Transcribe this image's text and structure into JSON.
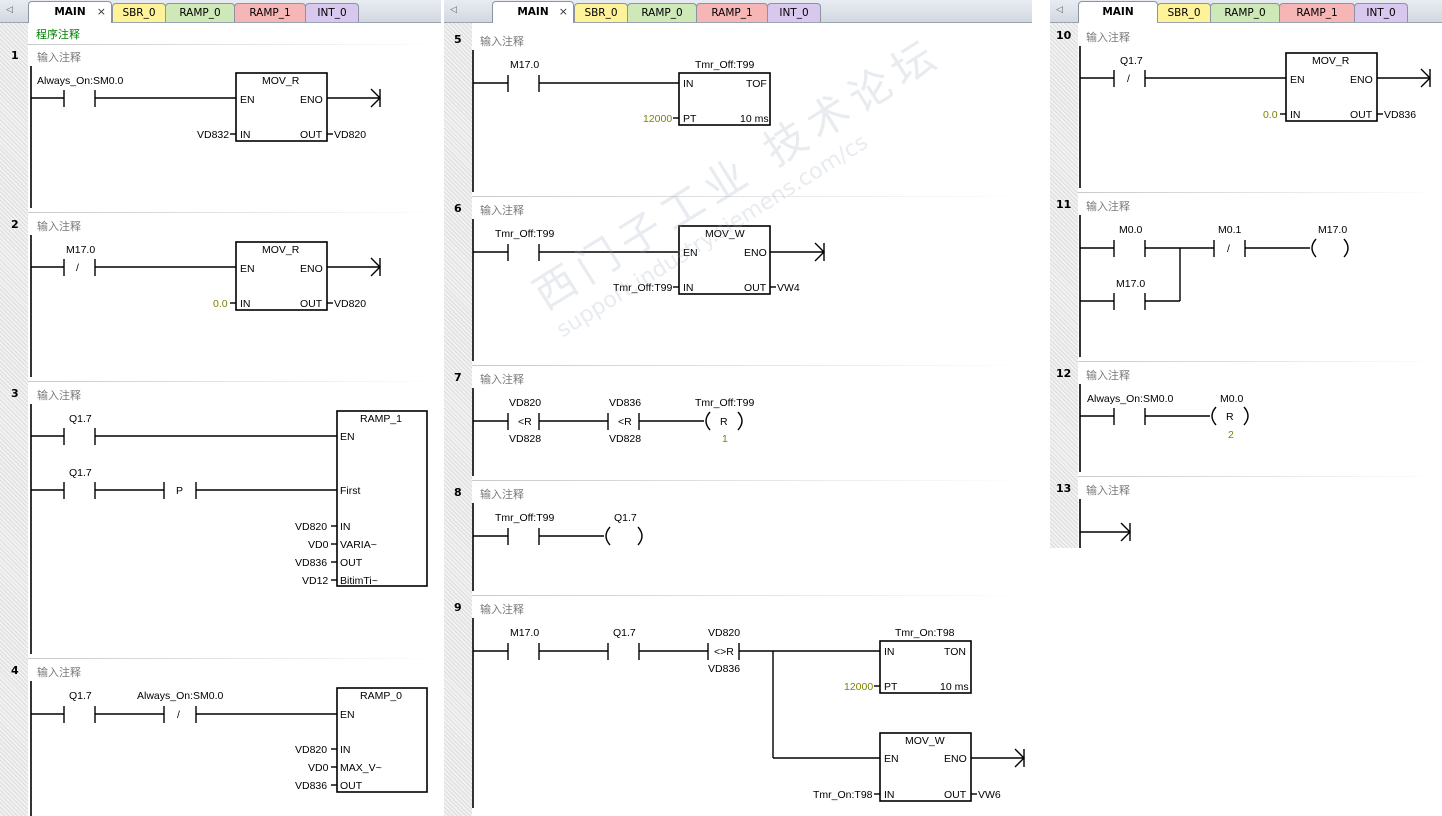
{
  "tabs": [
    "MAIN",
    "SBR_0",
    "RAMP_0",
    "RAMP_1",
    "INT_0"
  ],
  "program_comment": "程序注释",
  "rung_comment": "输入注释",
  "watermark": {
    "line1": "西门子工业 技术论坛",
    "line2": "support.industry.siemens.com/cs"
  },
  "rungs": {
    "r1": {
      "num": "1",
      "contact": "Always_On:SM0.0",
      "box": "MOV_R",
      "in": "VD832",
      "out": "VD820"
    },
    "r2": {
      "num": "2",
      "contact": "M17.0",
      "box": "MOV_R",
      "in": "0.0",
      "out": "VD820"
    },
    "r3": {
      "num": "3",
      "c1": "Q1.7",
      "c2": "Q1.7",
      "p": "P",
      "box": "RAMP_1",
      "pins": [
        "EN",
        "First",
        "IN",
        "VARIA~",
        "OUT",
        "BitimTi~"
      ],
      "args": [
        "VD820",
        "VD0",
        "VD836",
        "VD12"
      ]
    },
    "r4": {
      "num": "4",
      "c1": "Q1.7",
      "c2": "Always_On:SM0.0",
      "box": "RAMP_0",
      "pins": [
        "EN",
        "IN",
        "MAX_V~",
        "OUT"
      ],
      "args": [
        "VD820",
        "VD0",
        "VD836"
      ]
    },
    "r5": {
      "num": "5",
      "contact": "M17.0",
      "timer": "Tmr_Off:T99",
      "box": "TOF",
      "pt": "12000",
      "res": "10 ms"
    },
    "r6": {
      "num": "6",
      "contact": "Tmr_Off:T99",
      "box": "MOV_W",
      "in": "Tmr_Off:T99",
      "out": "VW4"
    },
    "r7": {
      "num": "7",
      "a1": "VD820",
      "op1": "<R",
      "b1": "VD828",
      "a2": "VD836",
      "op2": "<R",
      "b2": "VD828",
      "coil": "Tmr_Off:T99",
      "coil_type": "R",
      "n": "1"
    },
    "r8": {
      "num": "8",
      "contact": "Tmr_Off:T99",
      "coil": "Q1.7"
    },
    "r9": {
      "num": "9",
      "c1": "M17.0",
      "c2": "Q1.7",
      "a": "VD820",
      "op": "<>R",
      "b": "VD836",
      "timer": "Tmr_On:T98",
      "box1": "TON",
      "pt": "12000",
      "res": "10 ms",
      "box2": "MOV_W",
      "in": "Tmr_On:T98",
      "out": "VW6"
    },
    "r10": {
      "num": "10",
      "contact": "Q1.7",
      "box": "MOV_R",
      "in": "0.0",
      "out": "VD836"
    },
    "r11": {
      "num": "11",
      "c1": "M0.0",
      "c2": "M0.1",
      "c3": "M17.0",
      "coil": "M17.0"
    },
    "r12": {
      "num": "12",
      "contact": "Always_On:SM0.0",
      "coil": "M0.0",
      "coil_type": "R",
      "n": "2"
    },
    "r13": {
      "num": "13"
    }
  },
  "labels": {
    "en": "EN",
    "eno": "ENO",
    "in": "IN",
    "out": "OUT",
    "pt": "PT",
    "not": "/"
  }
}
